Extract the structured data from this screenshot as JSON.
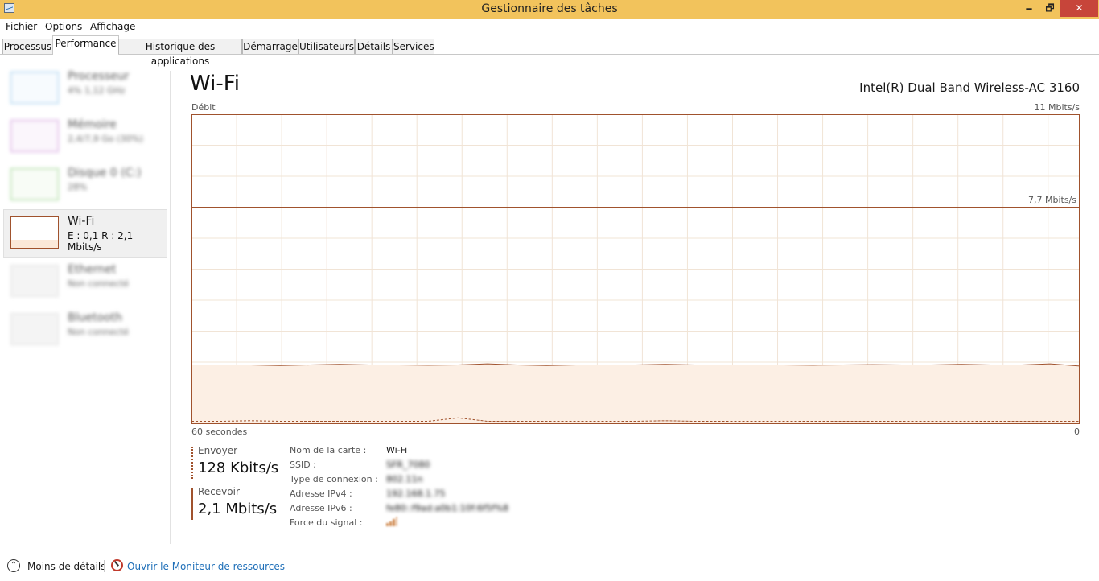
{
  "window": {
    "title": "Gestionnaire des tâches",
    "minimize_glyph": "🗕",
    "maximize_glyph": "🗗",
    "close_glyph": "✕"
  },
  "menu": {
    "items": [
      "Fichier",
      "Options",
      "Affichage"
    ]
  },
  "tabs": [
    "Processus",
    "Performance",
    "Historique des applications",
    "Démarrage",
    "Utilisateurs",
    "Détails",
    "Services"
  ],
  "active_tab": "Performance",
  "sidebar": {
    "items": [
      {
        "name": "Processeur",
        "sub": "4% 1,12 GHz",
        "color": "#4aa3df"
      },
      {
        "name": "Mémoire",
        "sub": "2,4/7,9 Go (30%)",
        "color": "#b35cc7"
      },
      {
        "name": "Disque 0 (C:)",
        "sub": "28%",
        "color": "#4caa3a"
      },
      {
        "name": "Wi-Fi",
        "sub": "E : 0,1 R : 2,1 Mbits/s",
        "color": "#a0522d"
      },
      {
        "name": "Ethernet",
        "sub": "Non connecté",
        "color": "#d0d0d0"
      },
      {
        "name": "Bluetooth",
        "sub": "Non connecté",
        "color": "#d0d0d0"
      }
    ]
  },
  "main": {
    "title": "Wi-Fi",
    "adapter": "Intel(R) Dual Band Wireless-AC 3160",
    "graph_label": "Débit",
    "graph_max_label": "11 Mbits/s",
    "graph_mid_label": "7,7 Mbits/s",
    "graph_time_label": "60 secondes",
    "graph_zero_label": "0"
  },
  "chart_data": {
    "type": "area",
    "title": "",
    "xlabel": "60 secondes",
    "ylabel": "Débit",
    "x_range": [
      60,
      0
    ],
    "ylim": [
      0,
      11
    ],
    "grid": true,
    "line_color": "#a0522d",
    "fill_color": "#fcefe4",
    "reference_line": 7.7,
    "series": [
      {
        "name": "Recevoir",
        "style": "solid",
        "values": [
          2.1,
          2.1,
          2.1,
          2.08,
          2.1,
          2.12,
          2.1,
          2.1,
          2.09,
          2.1,
          2.14,
          2.1,
          2.08,
          2.1,
          2.1,
          2.1,
          2.12,
          2.1,
          2.1,
          2.1,
          2.1,
          2.09,
          2.1,
          2.11,
          2.1,
          2.1,
          2.12,
          2.1,
          2.1,
          2.14,
          2.06
        ]
      },
      {
        "name": "Envoyer",
        "style": "dashed",
        "values": [
          0.1,
          0.1,
          0.12,
          0.1,
          0.1,
          0.1,
          0.1,
          0.1,
          0.1,
          0.22,
          0.1,
          0.1,
          0.1,
          0.1,
          0.1,
          0.1,
          0.12,
          0.1,
          0.1,
          0.1,
          0.1,
          0.1,
          0.1,
          0.1,
          0.1,
          0.1,
          0.1,
          0.1,
          0.1,
          0.1,
          0.1
        ]
      }
    ]
  },
  "stats": {
    "send_label": "Envoyer",
    "send_value": "128 Kbits/s",
    "receive_label": "Recevoir",
    "receive_value": "2,1 Mbits/s"
  },
  "properties": [
    {
      "label": "Nom de la carte :",
      "value": "Wi-Fi"
    },
    {
      "label": "SSID :",
      "value": "SFR_7080"
    },
    {
      "label": "Type de connexion :",
      "value": "802.11n"
    },
    {
      "label": "Adresse IPv4 :",
      "value": "192.168.1.75"
    },
    {
      "label": "Adresse IPv6 :",
      "value": "fe80::f9ad:a0b1:10f:6f5f%8"
    },
    {
      "label": "Force du signal :",
      "value": ""
    }
  ],
  "footer": {
    "less_details": "Moins de détails",
    "resource_monitor": "Ouvrir le Moniteur de ressources"
  }
}
